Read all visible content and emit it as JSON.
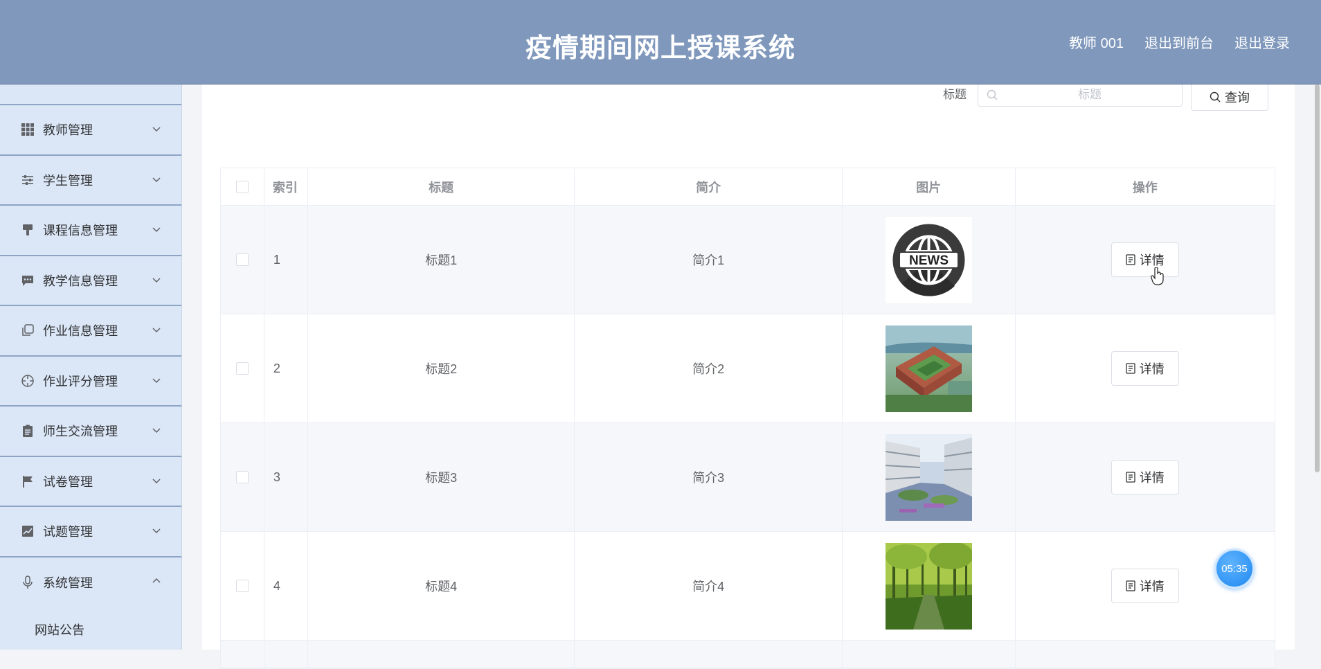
{
  "header": {
    "title": "疫情期间网上授课系统",
    "user": "教师 001",
    "to_front": "退出到前台",
    "logout": "退出登录"
  },
  "sidebar": {
    "items": [
      {
        "label": "教师管理",
        "icon": "grid-icon",
        "expanded": false
      },
      {
        "label": "学生管理",
        "icon": "sliders-icon",
        "expanded": false
      },
      {
        "label": "课程信息管理",
        "icon": "brush-icon",
        "expanded": false
      },
      {
        "label": "教学信息管理",
        "icon": "chat-icon",
        "expanded": false
      },
      {
        "label": "作业信息管理",
        "icon": "copy-icon",
        "expanded": false
      },
      {
        "label": "作业评分管理",
        "icon": "crosshair-icon",
        "expanded": false
      },
      {
        "label": "师生交流管理",
        "icon": "clipboard-icon",
        "expanded": false
      },
      {
        "label": "试卷管理",
        "icon": "flag-icon",
        "expanded": false
      },
      {
        "label": "试题管理",
        "icon": "chart-icon",
        "expanded": false
      },
      {
        "label": "系统管理",
        "icon": "microphone-icon",
        "expanded": true
      }
    ],
    "sub_items": [
      "网站公告"
    ]
  },
  "search": {
    "label": "标题",
    "placeholder": "标题",
    "button": "查询"
  },
  "table": {
    "columns": [
      "索引",
      "标题",
      "简介",
      "图片",
      "操作"
    ],
    "rows": [
      {
        "index": "1",
        "title": "标题1",
        "intro": "简介1",
        "image": "news-globe-image",
        "action": "详情"
      },
      {
        "index": "2",
        "title": "标题2",
        "intro": "简介2",
        "image": "campus-aerial-image",
        "action": "详情"
      },
      {
        "index": "3",
        "title": "标题3",
        "intro": "简介3",
        "image": "courtyard-image",
        "action": "详情"
      },
      {
        "index": "4",
        "title": "标题4",
        "intro": "简介4",
        "image": "forest-path-image",
        "action": "详情"
      }
    ]
  },
  "timer": "05:35",
  "colors": {
    "header": "#7f98bc",
    "sidebar": "#dbe7f7",
    "timer": "#1e88f0"
  }
}
